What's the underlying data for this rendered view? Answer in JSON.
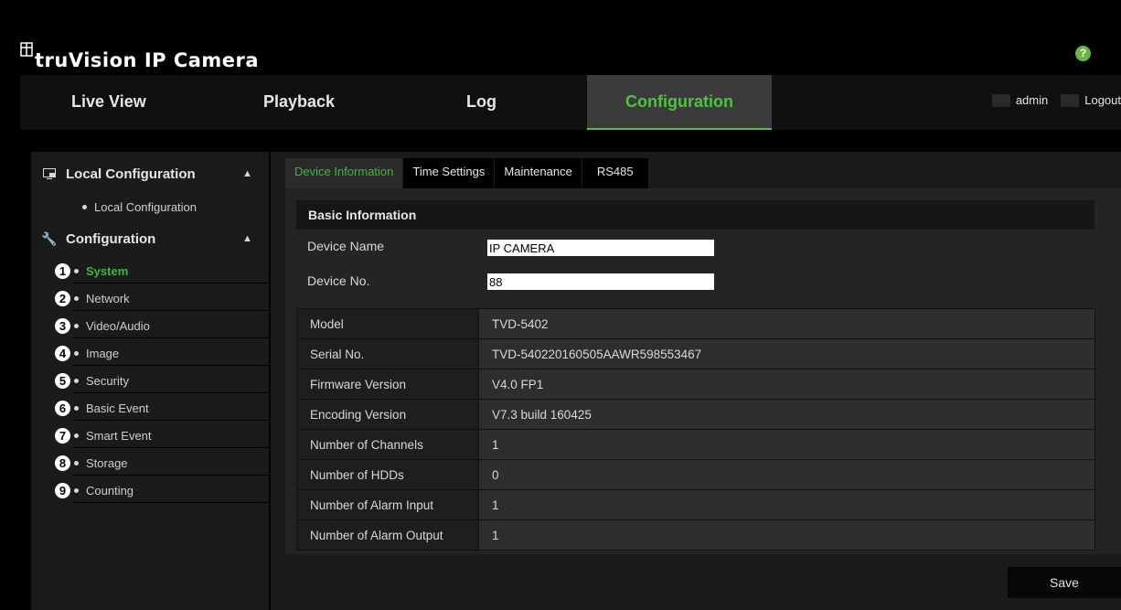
{
  "header": {
    "brand": "truVision IP Camera",
    "help": "?"
  },
  "nav": {
    "tabs": [
      {
        "label": "Live View"
      },
      {
        "label": "Playback"
      },
      {
        "label": "Log"
      },
      {
        "label": "Configuration",
        "active": true
      }
    ],
    "user": "admin",
    "logout": "Logout"
  },
  "sidebar": {
    "groups": [
      {
        "label": "Local Configuration",
        "icon": "monitor-icon",
        "items": [
          "Local Configuration"
        ]
      },
      {
        "label": "Configuration",
        "icon": "wrench-icon"
      }
    ],
    "config_items": [
      {
        "num": "1",
        "label": "System",
        "active": true
      },
      {
        "num": "2",
        "label": "Network"
      },
      {
        "num": "3",
        "label": "Video/Audio"
      },
      {
        "num": "4",
        "label": "Image"
      },
      {
        "num": "5",
        "label": "Security"
      },
      {
        "num": "6",
        "label": "Basic Event"
      },
      {
        "num": "7",
        "label": "Smart Event"
      },
      {
        "num": "8",
        "label": "Storage"
      },
      {
        "num": "9",
        "label": "Counting"
      }
    ]
  },
  "main": {
    "tabs": [
      {
        "label": "Device Information",
        "active": true
      },
      {
        "label": "Time Settings"
      },
      {
        "label": "Maintenance"
      },
      {
        "label": "RS485"
      }
    ],
    "section_title": "Basic Information",
    "device_name_label": "Device Name",
    "device_name_value": "IP CAMERA",
    "device_no_label": "Device No.",
    "device_no_value": "88",
    "info_rows": [
      {
        "key": "Model",
        "value": "TVD-5402"
      },
      {
        "key": "Serial No.",
        "value": "TVD-540220160505AAWR598553467"
      },
      {
        "key": "Firmware Version",
        "value": "V4.0 FP1"
      },
      {
        "key": "Encoding Version",
        "value": "V7.3 build 160425"
      },
      {
        "key": "Number of Channels",
        "value": "1"
      },
      {
        "key": "Number of HDDs",
        "value": "0"
      },
      {
        "key": "Number of Alarm Input",
        "value": "1"
      },
      {
        "key": "Number of Alarm Output",
        "value": "1"
      }
    ],
    "save_label": "Save"
  },
  "colors": {
    "accent": "#3fb63f",
    "background": "#000000",
    "panel": "#1b1b1b"
  }
}
